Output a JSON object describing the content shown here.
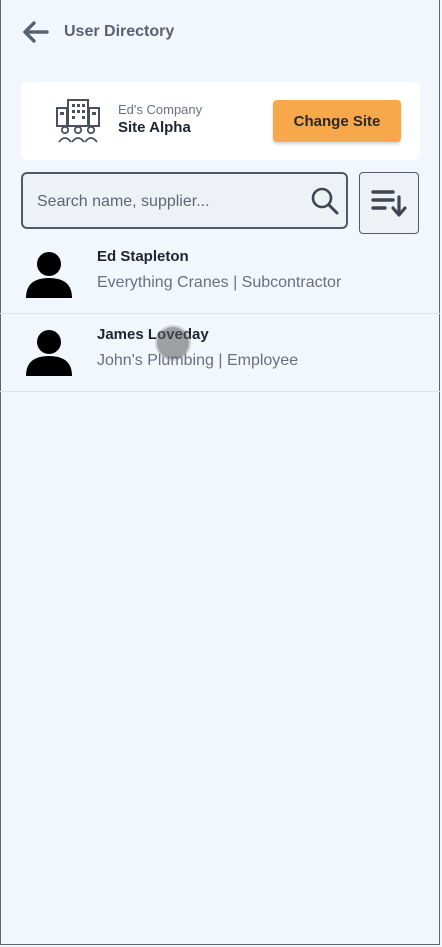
{
  "header": {
    "title": "User Directory",
    "back_icon": "arrow-left-icon"
  },
  "site_card": {
    "company": "Ed's Company",
    "site": "Site Alpha",
    "change_label": "Change Site",
    "icon": "building-people-icon",
    "button_color": "#f7a84b"
  },
  "search": {
    "placeholder": "Search name, supplier...",
    "value": "",
    "icon": "search-icon"
  },
  "sort": {
    "icon": "sort-descending-icon"
  },
  "users": [
    {
      "name": "Ed Stapleton",
      "subtitle": "Everything Cranes | Subcontractor",
      "avatar": "person-icon"
    },
    {
      "name": "James Loveday",
      "subtitle": "John's Plumbing | Employee",
      "avatar": "person-icon"
    }
  ]
}
